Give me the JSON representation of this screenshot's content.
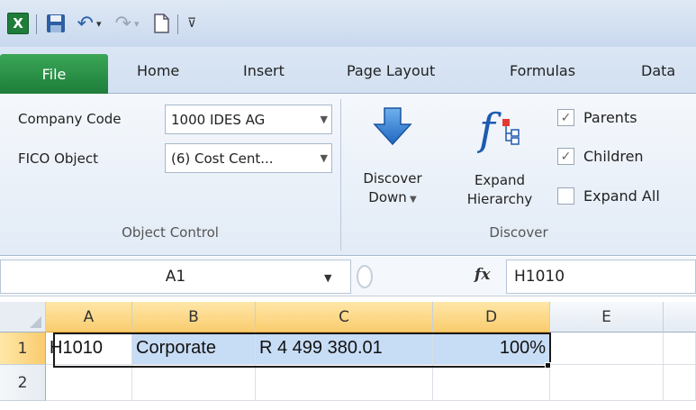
{
  "quick_access": {
    "excel_icon": "X",
    "undo_icon": "↶",
    "redo_icon": "↷",
    "customize_icon": "⊽"
  },
  "tabs": [
    "File",
    "Home",
    "Insert",
    "Page Layout",
    "Formulas",
    "Data"
  ],
  "ribbon": {
    "object_control": {
      "company_code_label": "Company Code",
      "company_code_value": "1000 IDES AG",
      "fico_object_label": "FICO Object",
      "fico_object_value": "(6) Cost Cent...",
      "group_label": "Object Control"
    },
    "discover": {
      "discover_down_line1": "Discover",
      "discover_down_line2": "Down",
      "expand_hierarchy_line1": "Expand",
      "expand_hierarchy_line2": "Hierarchy",
      "parents_label": "Parents",
      "parents_checked": true,
      "children_label": "Children",
      "children_checked": true,
      "expand_all_label": "Expand All",
      "expand_all_checked": false,
      "group_label": "Discover"
    }
  },
  "formula_bar": {
    "name_box": "A1",
    "fx": "fx",
    "formula": "H1010"
  },
  "grid": {
    "columns": [
      "A",
      "B",
      "C",
      "D",
      "E"
    ],
    "rows": [
      "1",
      "2"
    ],
    "cells": {
      "A1": "H1010",
      "B1": "Corporate",
      "C1": "R 4 499 380.01",
      "D1": "100%"
    }
  },
  "colors": {
    "file_tab": "#1e7d3a",
    "selection_fill": "#c7dcf5",
    "header_highlight": "#f9cc6e",
    "arrow_blue": "#2f7fd2"
  }
}
